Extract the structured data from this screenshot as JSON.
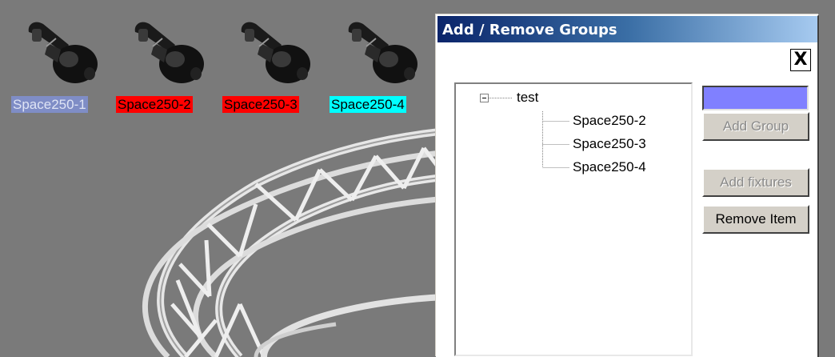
{
  "fixtures": [
    {
      "label": "Space250-1",
      "label_bg": "#7f8dc6",
      "label_color": "#dfe4f5"
    },
    {
      "label": "Space250-2",
      "label_bg": "#ff0000",
      "label_color": "#000000"
    },
    {
      "label": "Space250-3",
      "label_bg": "#ff0000",
      "label_color": "#000000"
    },
    {
      "label": "Space250-4",
      "label_bg": "#00ffff",
      "label_color": "#000000"
    }
  ],
  "dialog": {
    "title": "Add / Remove Groups",
    "close_label": "X",
    "tree": {
      "root": {
        "label": "test",
        "expander": "minus-icon"
      },
      "children": [
        "Space250-2",
        "Space250-3",
        "Space250-4"
      ]
    },
    "group_name_input": {
      "value": "",
      "bg_color": "#8080ff"
    },
    "buttons": {
      "add_group": "Add Group",
      "add_fixtures": "Add fixtures",
      "remove_item": "Remove Item"
    }
  },
  "colors": {
    "background": "#7a7a7a",
    "titlebar_start": "#0a246a",
    "titlebar_end": "#a6caf0",
    "button_face": "#d4d0c8"
  }
}
